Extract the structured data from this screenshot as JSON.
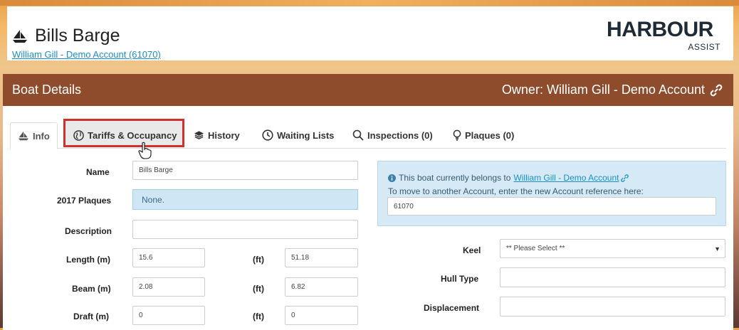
{
  "header": {
    "title": "Bills Barge",
    "account_link": "William Gill - Demo Account (61070)",
    "logo_main": "HARBOUR",
    "logo_sub": "ASSIST"
  },
  "panel": {
    "title": "Boat Details",
    "owner": "Owner: William Gill - Demo Account"
  },
  "tabs": [
    {
      "label": "Info",
      "icon": "boat-icon",
      "active": true
    },
    {
      "label": "Tariffs & Occupancy",
      "icon": "globe-icon",
      "active": false
    },
    {
      "label": "History",
      "icon": "layers-icon",
      "active": false
    },
    {
      "label": "Waiting Lists",
      "icon": "clock-icon",
      "active": false
    },
    {
      "label": "Inspections (0)",
      "icon": "search-icon",
      "active": false
    },
    {
      "label": "Plaques (0)",
      "icon": "lightbulb-icon",
      "active": false
    }
  ],
  "form": {
    "name_label": "Name",
    "name_value": "Bills Barge",
    "plaques_label": "2017 Plaques",
    "plaques_value": "None.",
    "description_label": "Description",
    "description_value": "",
    "length_label": "Length (m)",
    "length_m": "15.6",
    "ft_label": "(ft)",
    "length_ft": "51.18",
    "beam_label": "Beam (m)",
    "beam_m": "2.08",
    "beam_ft": "6.82",
    "draft_label": "Draft (m)",
    "draft_m": "0",
    "draft_ft": "0"
  },
  "info": {
    "line1_prefix": "This boat currently belongs to",
    "line1_link": "William Gill - Demo Account",
    "line2": "To move to another Account, enter the new Account reference here:",
    "account_ref": "61070"
  },
  "right_form": {
    "keel_label": "Keel",
    "keel_value": "** Please Select **",
    "hull_label": "Hull Type",
    "hull_value": "",
    "displacement_label": "Displacement",
    "displacement_value": ""
  },
  "colors": {
    "panel_header": "#8f4c2c",
    "link": "#1a8ecb",
    "highlight_border": "#d0312d",
    "info_bg": "#d5eaf6"
  }
}
